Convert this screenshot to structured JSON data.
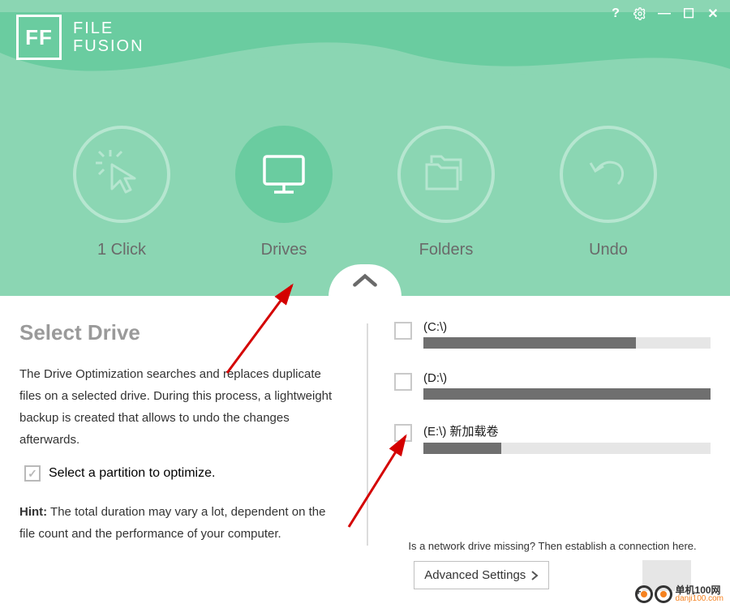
{
  "app": {
    "logo_short": "FF",
    "title_line1": "FILE",
    "title_line2": "FUSION"
  },
  "window_controls": {
    "help": "?",
    "settings": "⚙",
    "minimize": "—",
    "maximize": "☐",
    "close": "✕"
  },
  "nav": {
    "items": [
      {
        "id": "oneclick",
        "label": "1 Click",
        "icon": "cursor-click-icon",
        "active": false
      },
      {
        "id": "drives",
        "label": "Drives",
        "icon": "monitor-icon",
        "active": true
      },
      {
        "id": "folders",
        "label": "Folders",
        "icon": "folders-icon",
        "active": false
      },
      {
        "id": "undo",
        "label": "Undo",
        "icon": "undo-arrow-icon",
        "active": false
      }
    ]
  },
  "left": {
    "heading": "Select Drive",
    "description": "The Drive Optimization searches and replaces duplicate files on a selected drive. During this process, a lightweight backup is created that allows to undo the changes afterwards.",
    "select_hint": "Select a partition to optimize.",
    "hint_label": "Hint:",
    "hint_text": " The total duration may vary a lot, dependent on the file count and the performance of your computer."
  },
  "drives": [
    {
      "label": "(C:\\)",
      "fill_percent": 74,
      "checked": false
    },
    {
      "label": "(D:\\)",
      "fill_percent": 100,
      "checked": false
    },
    {
      "label": "(E:\\) 新加载卷",
      "fill_percent": 27,
      "checked": false
    }
  ],
  "bottom": {
    "network_hint": "Is a network drive missing? Then establish a connection here.",
    "advanced_label": "Advanced Settings"
  },
  "watermark": {
    "line1": "单机100网",
    "line2": "danji100.com"
  }
}
